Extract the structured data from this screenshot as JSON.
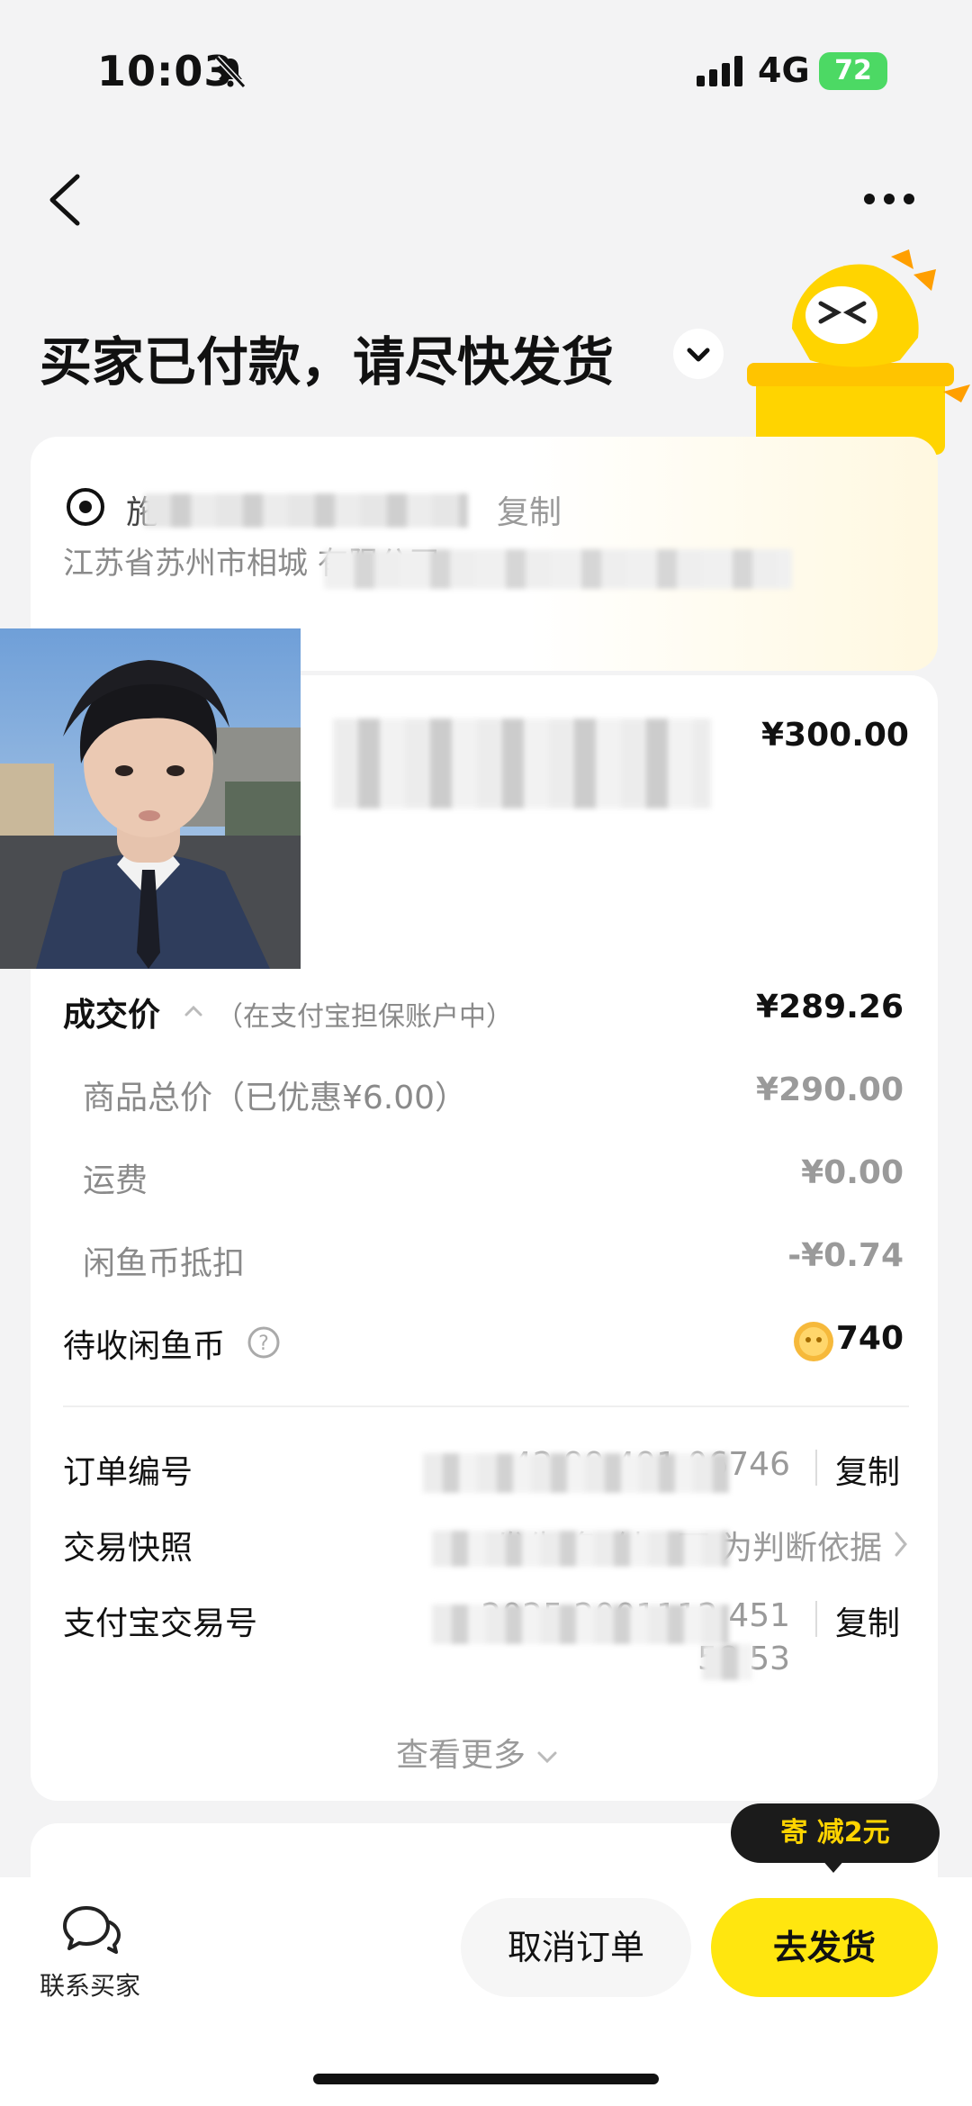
{
  "status_bar": {
    "time": "10:03",
    "network": "4G",
    "battery": "72"
  },
  "header": {
    "title": "买家已付款，请尽快发货"
  },
  "address": {
    "name_prefix": "施",
    "phone_suffix": "7",
    "copy_label": "复制",
    "detail": "江苏省苏州市相城                                   有限公司"
  },
  "product": {
    "price": "¥300.00"
  },
  "summary": {
    "deal_label": "成交价",
    "deal_hint": "（在支付宝担保账户中）",
    "deal_value": "¥289.26",
    "rows": [
      {
        "label": "商品总价（已优惠¥6.00）",
        "value": "¥290.00"
      },
      {
        "label": "运费",
        "value": "¥0.00"
      },
      {
        "label": "闲鱼币抵扣",
        "value": "-¥0.74"
      }
    ],
    "coins_label": "待收闲鱼币",
    "coins_value": "740"
  },
  "order_info": {
    "order_no_label": "订单编号",
    "order_no_value": "42      99     491    06746",
    "snapshot_label": "交易快照",
    "snapshot_value": "发生      争     付，可     为判断依据",
    "alipay_label": "支付宝交易号",
    "alipay_value_line1": "2025            2001112      451",
    "alipay_value_line2": "58     53",
    "copy_label": "复制"
  },
  "see_more": "查看更多",
  "promo": {
    "text": "寄      减2元"
  },
  "bottom": {
    "contact_label": "联系买家",
    "cancel_label": "取消订单",
    "ship_label": "去发货"
  },
  "colors": {
    "accent": "#ffe60f",
    "battery": "#4cd964"
  }
}
